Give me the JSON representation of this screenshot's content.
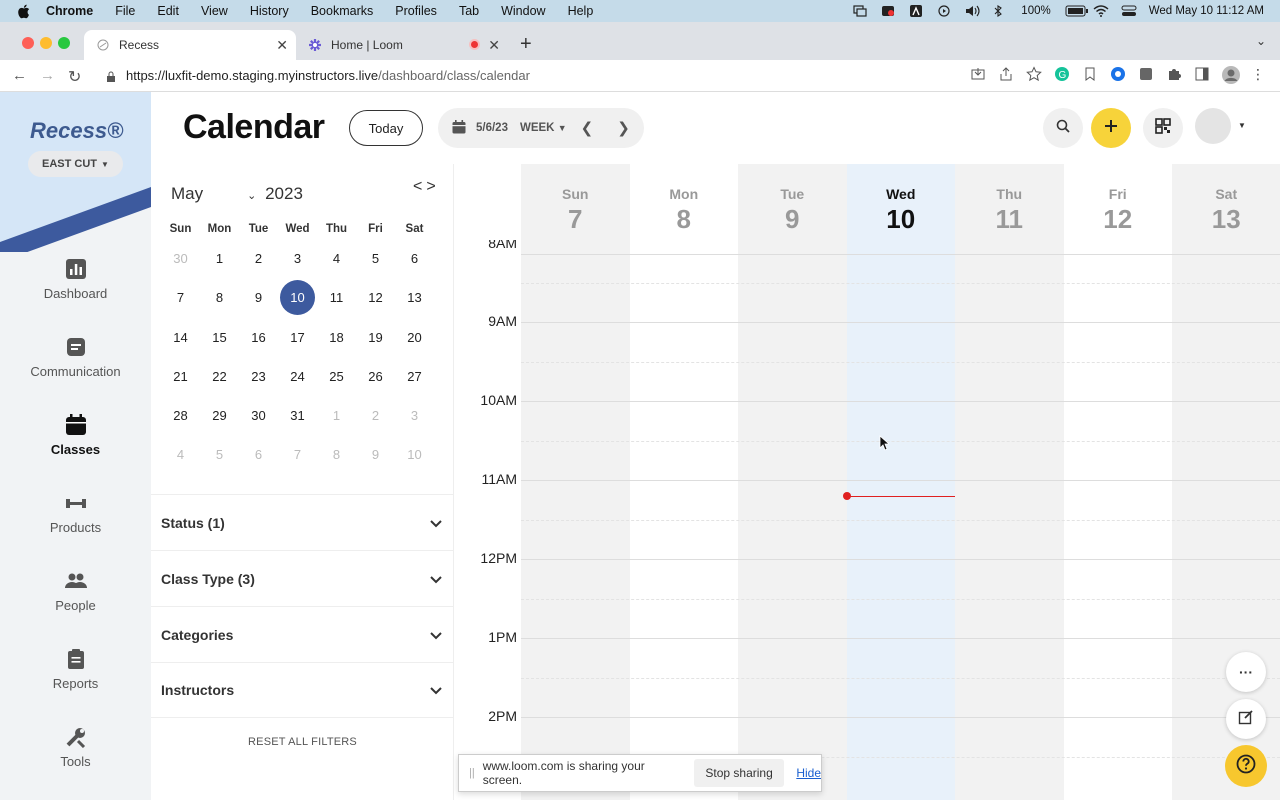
{
  "menubar": {
    "app": "Chrome",
    "items": [
      "File",
      "Edit",
      "View",
      "History",
      "Bookmarks",
      "Profiles",
      "Tab",
      "Window",
      "Help"
    ],
    "battery": "100%",
    "datetime": "Wed May 10  11:12 AM"
  },
  "browser": {
    "tabs": [
      {
        "title": "Recess",
        "icon": "page-icon"
      },
      {
        "title": "Home | Loom",
        "icon": "loom-icon"
      }
    ],
    "url_host": "https://luxfit-demo.staging.myinstructors.live",
    "url_path": "/dashboard/class/calendar"
  },
  "sidebar": {
    "logo": "Recess®",
    "location": "EAST CUT",
    "items": [
      {
        "label": "Dashboard",
        "icon": "chart-icon"
      },
      {
        "label": "Communication",
        "icon": "message-icon"
      },
      {
        "label": "Classes",
        "icon": "calendar-icon"
      },
      {
        "label": "Products",
        "icon": "dumbbell-icon"
      },
      {
        "label": "People",
        "icon": "people-icon"
      },
      {
        "label": "Reports",
        "icon": "clipboard-icon"
      },
      {
        "label": "Tools",
        "icon": "tools-icon"
      }
    ],
    "active": "Classes",
    "colors": {
      "accent": "#3d5a9e",
      "hero_light": "#d5e6f7"
    }
  },
  "header": {
    "title": "Calendar",
    "today_label": "Today",
    "date_label": "5/6/23",
    "view_label": "WEEK"
  },
  "minicalendar": {
    "month": "May",
    "year": "2023",
    "dow": [
      "Sun",
      "Mon",
      "Tue",
      "Wed",
      "Thu",
      "Fri",
      "Sat"
    ],
    "weeks": [
      [
        [
          "30",
          true
        ],
        [
          "1",
          false
        ],
        [
          "2",
          false
        ],
        [
          "3",
          false
        ],
        [
          "4",
          false
        ],
        [
          "5",
          false
        ],
        [
          "6",
          false
        ]
      ],
      [
        [
          "7",
          false
        ],
        [
          "8",
          false
        ],
        [
          "9",
          false
        ],
        [
          "10",
          false
        ],
        [
          "11",
          false
        ],
        [
          "12",
          false
        ],
        [
          "13",
          false
        ]
      ],
      [
        [
          "14",
          false
        ],
        [
          "15",
          false
        ],
        [
          "16",
          false
        ],
        [
          "17",
          false
        ],
        [
          "18",
          false
        ],
        [
          "19",
          false
        ],
        [
          "20",
          false
        ]
      ],
      [
        [
          "21",
          false
        ],
        [
          "22",
          false
        ],
        [
          "23",
          false
        ],
        [
          "24",
          false
        ],
        [
          "25",
          false
        ],
        [
          "26",
          false
        ],
        [
          "27",
          false
        ]
      ],
      [
        [
          "28",
          false
        ],
        [
          "29",
          false
        ],
        [
          "30",
          false
        ],
        [
          "31",
          false
        ],
        [
          "1",
          true
        ],
        [
          "2",
          true
        ],
        [
          "3",
          true
        ]
      ],
      [
        [
          "4",
          true
        ],
        [
          "5",
          true
        ],
        [
          "6",
          true
        ],
        [
          "7",
          true
        ],
        [
          "8",
          true
        ],
        [
          "9",
          true
        ],
        [
          "10",
          true
        ]
      ]
    ],
    "selected": "10"
  },
  "filters": {
    "items": [
      "Status (1)",
      "Class Type (3)",
      "Categories",
      "Instructors"
    ],
    "reset_label": "RESET ALL FILTERS"
  },
  "week": {
    "days": [
      {
        "name": "Sun",
        "date": "7"
      },
      {
        "name": "Mon",
        "date": "8"
      },
      {
        "name": "Tue",
        "date": "9"
      },
      {
        "name": "Wed",
        "date": "10",
        "today": true
      },
      {
        "name": "Thu",
        "date": "11"
      },
      {
        "name": "Fri",
        "date": "12"
      },
      {
        "name": "Sat",
        "date": "13"
      }
    ],
    "hours": [
      "8AM",
      "9AM",
      "10AM",
      "11AM",
      "12PM",
      "1PM",
      "2PM"
    ],
    "current_time": "11:12 AM",
    "colors": {
      "today_col": "#e8f1fa",
      "shaded_col": "#f2f2f2",
      "now": "#e02020"
    }
  },
  "screenshare": {
    "message": "www.loom.com is sharing your screen.",
    "stop_label": "Stop sharing",
    "hide_label": "Hide"
  },
  "fabs": {
    "more_label": "···"
  }
}
